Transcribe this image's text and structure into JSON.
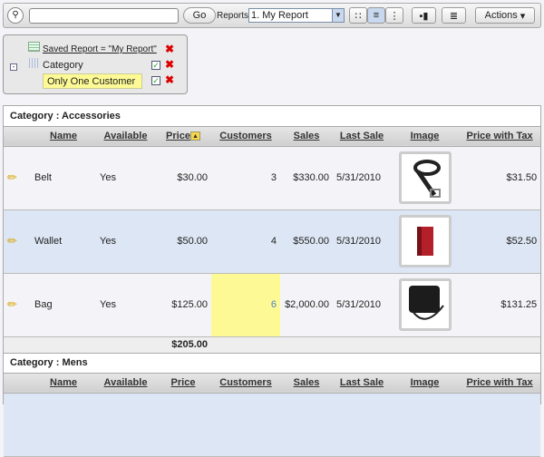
{
  "toolbar": {
    "go_label": "Go",
    "reports_label": "Reports",
    "report_selected": "1. My Report",
    "actions_label": "Actions",
    "search_value": ""
  },
  "filters": {
    "saved_report": "Saved Report = \"My Report\"",
    "control_break": "Category",
    "highlight": "Only One Customer"
  },
  "columns": [
    "Name",
    "Available",
    "Price",
    "Customers",
    "Sales",
    "Last Sale",
    "Image",
    "Price with Tax"
  ],
  "groups": [
    {
      "category": "Category : Accessories",
      "rows": [
        {
          "name": "Belt",
          "available": "Yes",
          "price": "$30.00",
          "customers": "3",
          "sales": "$330.00",
          "last_sale": "5/31/2010",
          "image": "belt",
          "price_tax": "$31.50"
        },
        {
          "name": "Wallet",
          "available": "Yes",
          "price": "$50.00",
          "customers": "4",
          "sales": "$550.00",
          "last_sale": "5/31/2010",
          "image": "wallet",
          "price_tax": "$52.50"
        },
        {
          "name": "Bag",
          "available": "Yes",
          "price": "$125.00",
          "customers": "6",
          "sales": "$2,000.00",
          "last_sale": "5/31/2010",
          "image": "bag",
          "price_tax": "$131.25"
        }
      ],
      "total_price": "$205.00"
    },
    {
      "category": "Category : Mens"
    }
  ],
  "colors": {
    "highlight": "#fdfa96",
    "alt_row": "#dde6f4"
  }
}
